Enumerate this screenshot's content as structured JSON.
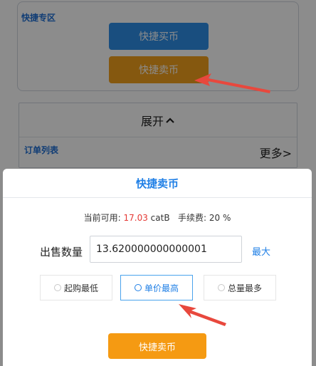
{
  "background": {
    "quick_zone_title": "快捷专区",
    "buy_button": "快捷买币",
    "sell_button": "快捷卖币",
    "expand_label": "展开",
    "order_list_title": "订单列表",
    "more_link": "更多>"
  },
  "sheet": {
    "title": "快捷卖币",
    "balance_prefix": "当前可用:",
    "balance_value": "17.03",
    "balance_unit": "catB",
    "fee_label": "手续费:",
    "fee_value": "20 %",
    "quantity_label": "出售数量",
    "quantity_value": "13.620000000000001",
    "max_label": "最大",
    "options": [
      {
        "label": "起购最低",
        "selected": false
      },
      {
        "label": "单价最高",
        "selected": true
      },
      {
        "label": "总量最多",
        "selected": false
      }
    ],
    "submit_label": "快捷卖币"
  },
  "colors": {
    "accent_blue": "#1f7fe6",
    "orange": "#f59a12",
    "arrow_red": "#e8483d"
  }
}
